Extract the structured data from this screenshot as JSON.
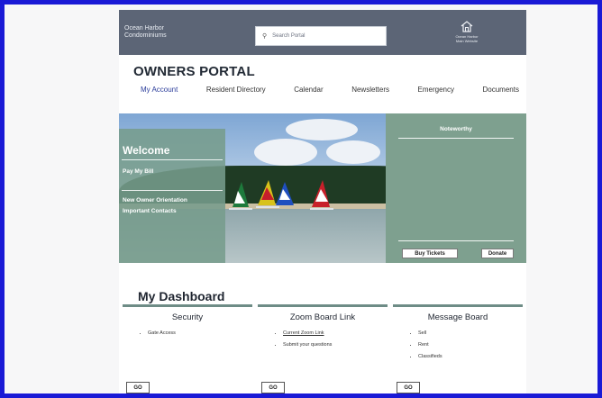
{
  "header": {
    "brand_line1": "Ocean Harbor",
    "brand_line2": "Condominiums",
    "search_placeholder": "Search Portal",
    "home_caption_line1": "Ocean Harbor",
    "home_caption_line2": "Main Website"
  },
  "portal_title": "OWNERS PORTAL",
  "nav": [
    {
      "label": "My Account",
      "active": true
    },
    {
      "label": "Resident Directory"
    },
    {
      "label": "Calendar"
    },
    {
      "label": "Newsletters"
    },
    {
      "label": "Emergency"
    },
    {
      "label": "Documents"
    }
  ],
  "welcome": {
    "title": "Welcome",
    "links": [
      "Pay My Bill",
      "New Owner Orientation",
      "Important Contacts"
    ]
  },
  "noteworthy": {
    "title": "Noteworthy",
    "buy_tickets": "Buy Tickets",
    "donate": "Donate"
  },
  "dashboard": {
    "title": "My Dashboard",
    "cards": [
      {
        "title": "Security",
        "items": [
          "Gate Access"
        ],
        "go": "GO"
      },
      {
        "title": "Zoom Board Link",
        "items": [
          "Current Zoom Link",
          "Submit your questions"
        ],
        "go": "GO"
      },
      {
        "title": "Message Board",
        "items": [
          "Sell",
          "Rent",
          "Classifieds"
        ],
        "go": "GO"
      }
    ]
  },
  "colors": {
    "frame_border": "#1a1ad6",
    "topbar": "#5c6576",
    "accent_green": "#6e8c86",
    "nav_active": "#2a3c9a"
  }
}
